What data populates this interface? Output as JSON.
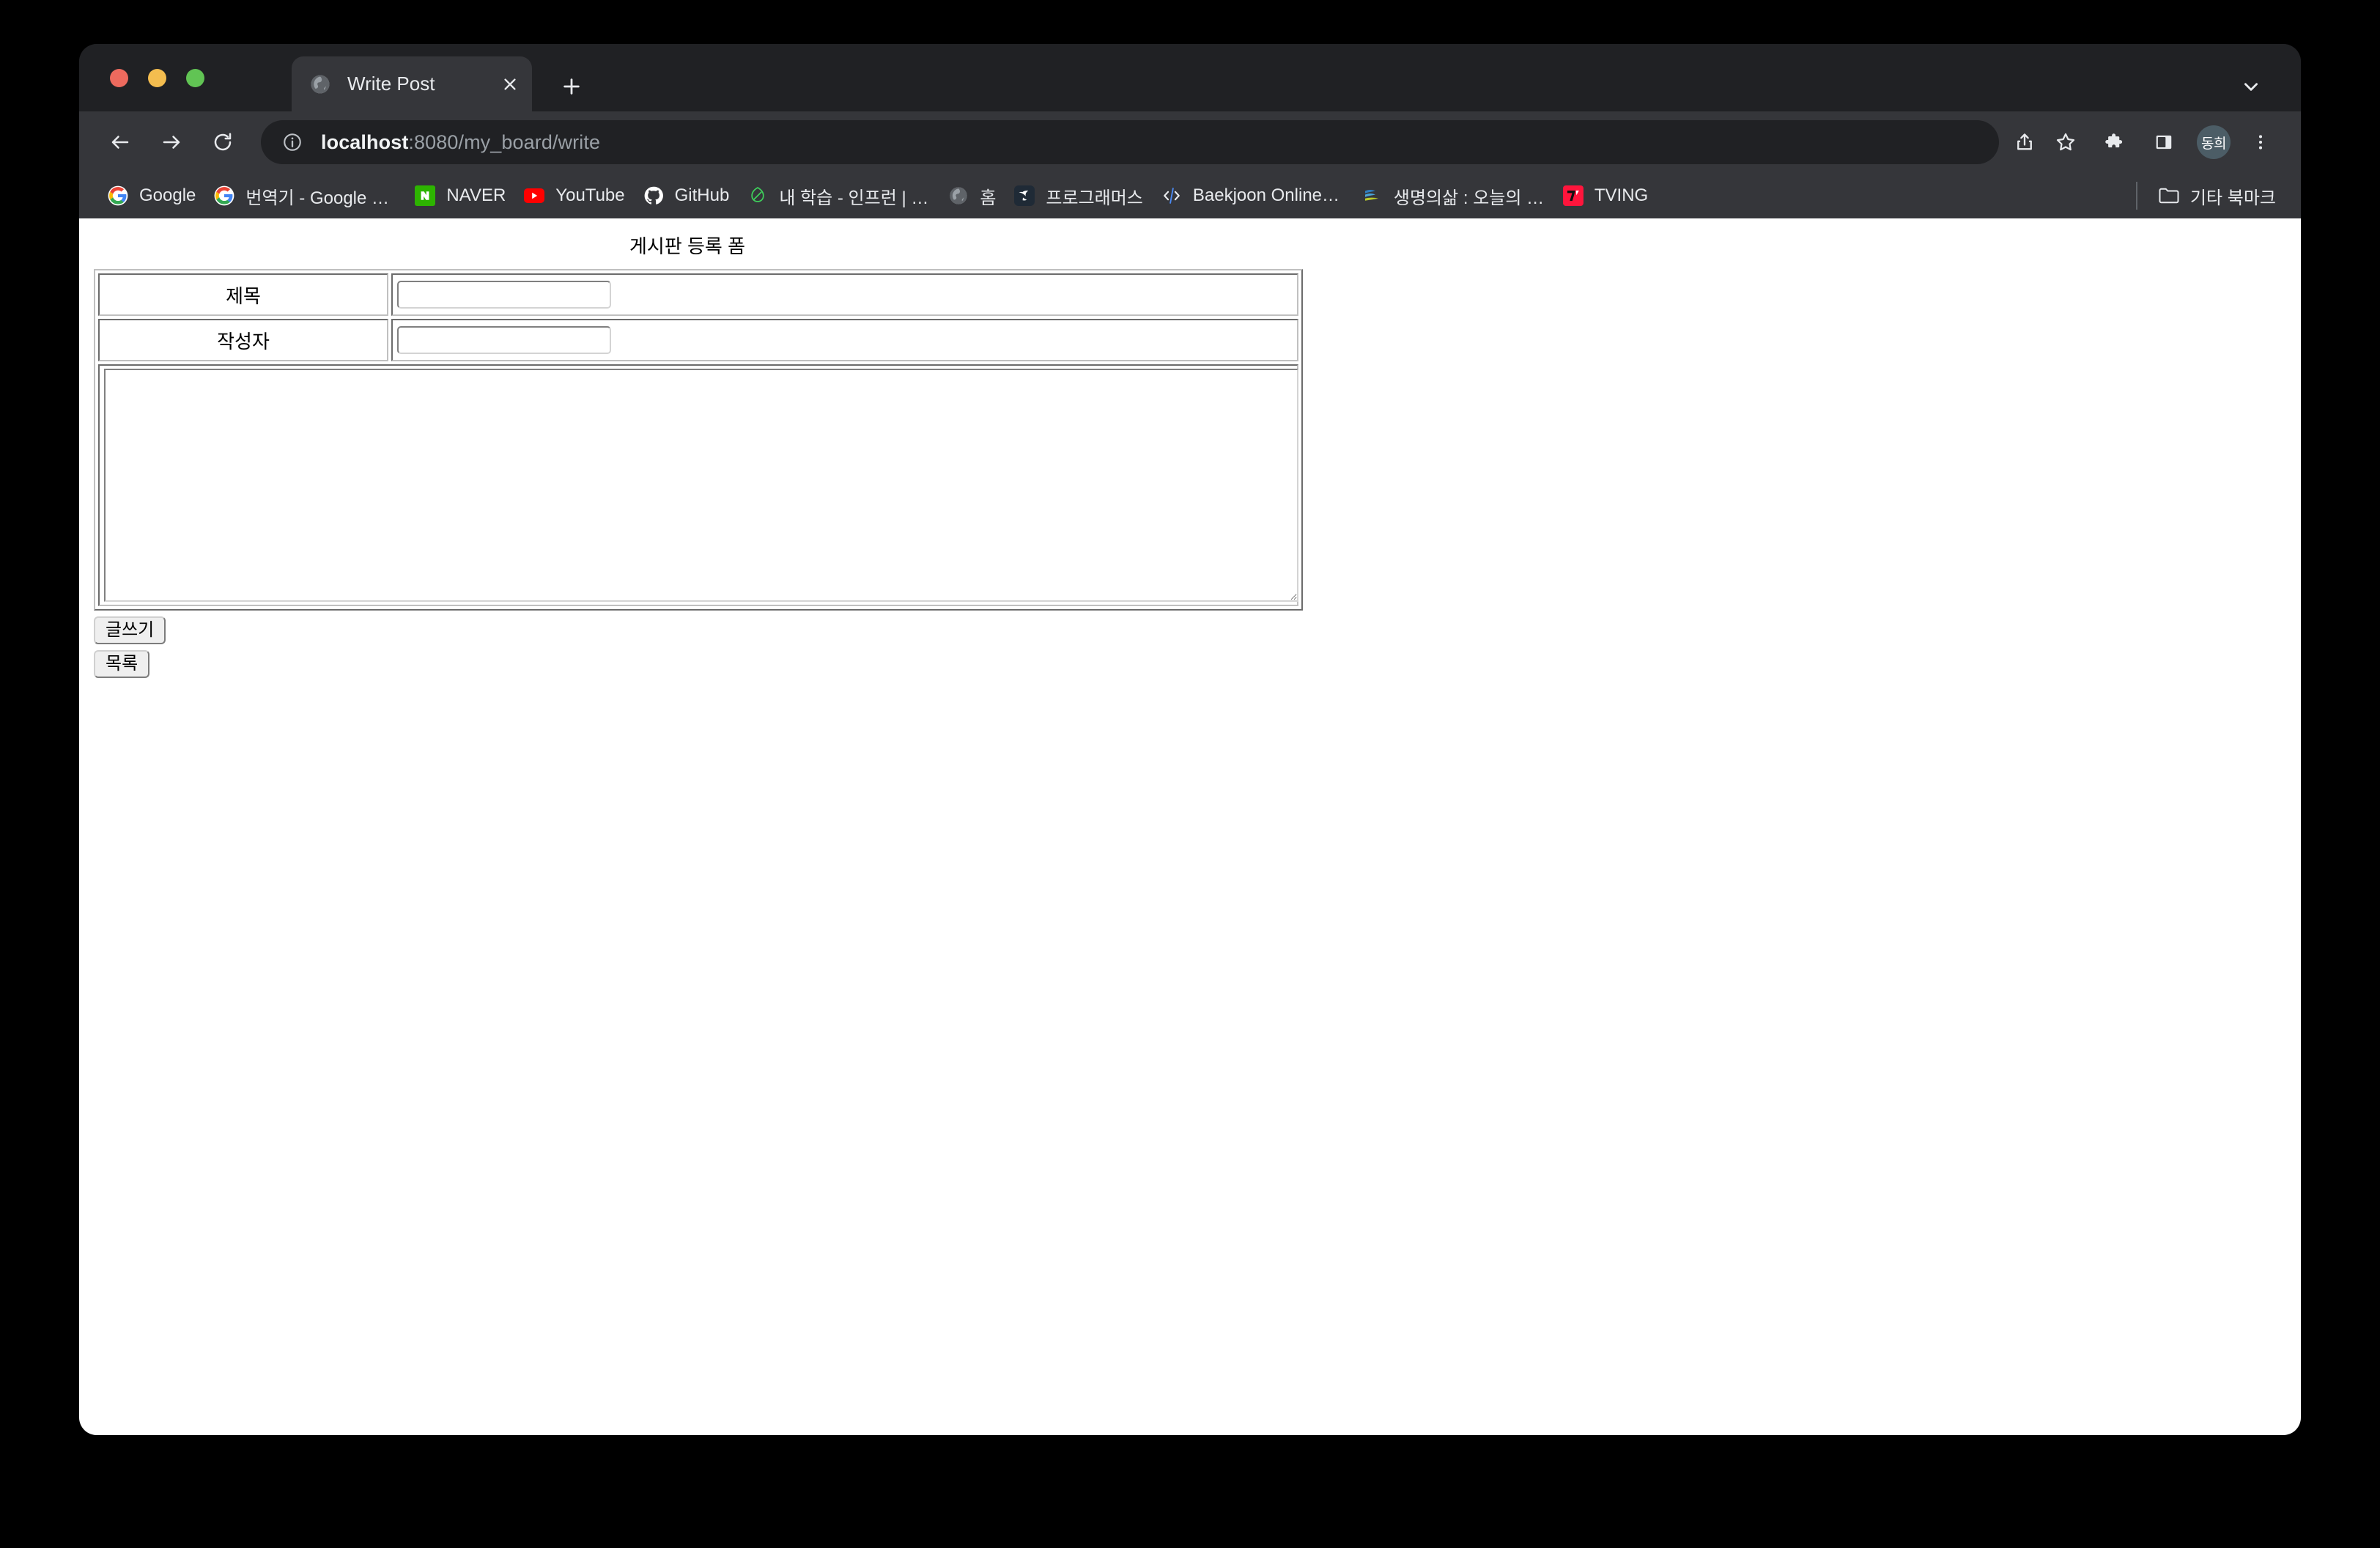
{
  "window": {
    "traffic_lights": [
      "close",
      "minimize",
      "maximize"
    ]
  },
  "tab_strip": {
    "tabs": [
      {
        "title": "Write Post",
        "favicon": "globe-icon",
        "active": true
      }
    ],
    "new_tab_label": "+",
    "tab_search_label": "v"
  },
  "toolbar": {
    "back_label": "Back",
    "forward_label": "Forward",
    "reload_label": "Reload",
    "url_host": "localhost",
    "url_rest": ":8080/my_board/write",
    "url_full": "localhost:8080/my_board/write",
    "site_info_icon": "info-circle-icon",
    "share_icon": "share-icon",
    "bookmark_icon": "star-icon",
    "extensions_icon": "puzzle-icon",
    "side_panel_icon": "side-panel-icon",
    "menu_icon": "three-dots-icon",
    "profile_initials": "동희"
  },
  "bookmarks_bar": {
    "items": [
      {
        "label": "Google",
        "icon": "google-icon"
      },
      {
        "label": "번역기 - Google 검색",
        "icon": "google-icon"
      },
      {
        "label": "NAVER",
        "icon": "naver-icon"
      },
      {
        "label": "YouTube",
        "icon": "youtube-icon"
      },
      {
        "label": "GitHub",
        "icon": "github-icon"
      },
      {
        "label": "내 학습 - 인프런 | 마...",
        "icon": "inflearn-icon"
      },
      {
        "label": "홈",
        "icon": "globe-icon"
      },
      {
        "label": "프로그래머스",
        "icon": "programmers-icon"
      },
      {
        "label": "Baekjoon Online J...",
        "icon": "code-brackets-icon"
      },
      {
        "label": "생명의삶 : 오늘의 QT...",
        "icon": "duranno-icon"
      },
      {
        "label": "TVING",
        "icon": "tving-icon"
      }
    ],
    "other_bookmarks_label": "기타 북마크",
    "other_bookmarks_icon": "folder-icon"
  },
  "page": {
    "title": "게시판 등록 폼",
    "form": {
      "rows": [
        {
          "label": "제목",
          "value": "",
          "placeholder": "",
          "name": "title"
        },
        {
          "label": "작성자",
          "value": "",
          "placeholder": "",
          "name": "writer"
        }
      ],
      "content": {
        "value": "",
        "placeholder": "",
        "name": "content"
      },
      "buttons": [
        {
          "label": "글쓰기",
          "name": "submit"
        },
        {
          "label": "목록",
          "name": "list"
        }
      ]
    }
  },
  "colors": {
    "tab_strip_bg": "#202124",
    "toolbar_bg": "#35363a",
    "omnibox_bg": "#202124",
    "text_primary": "#e8eaed",
    "text_secondary": "#9aa0a6",
    "avatar_bg": "#4c5d66",
    "page_bg": "#ffffff",
    "desktop_bg": "#000000"
  }
}
